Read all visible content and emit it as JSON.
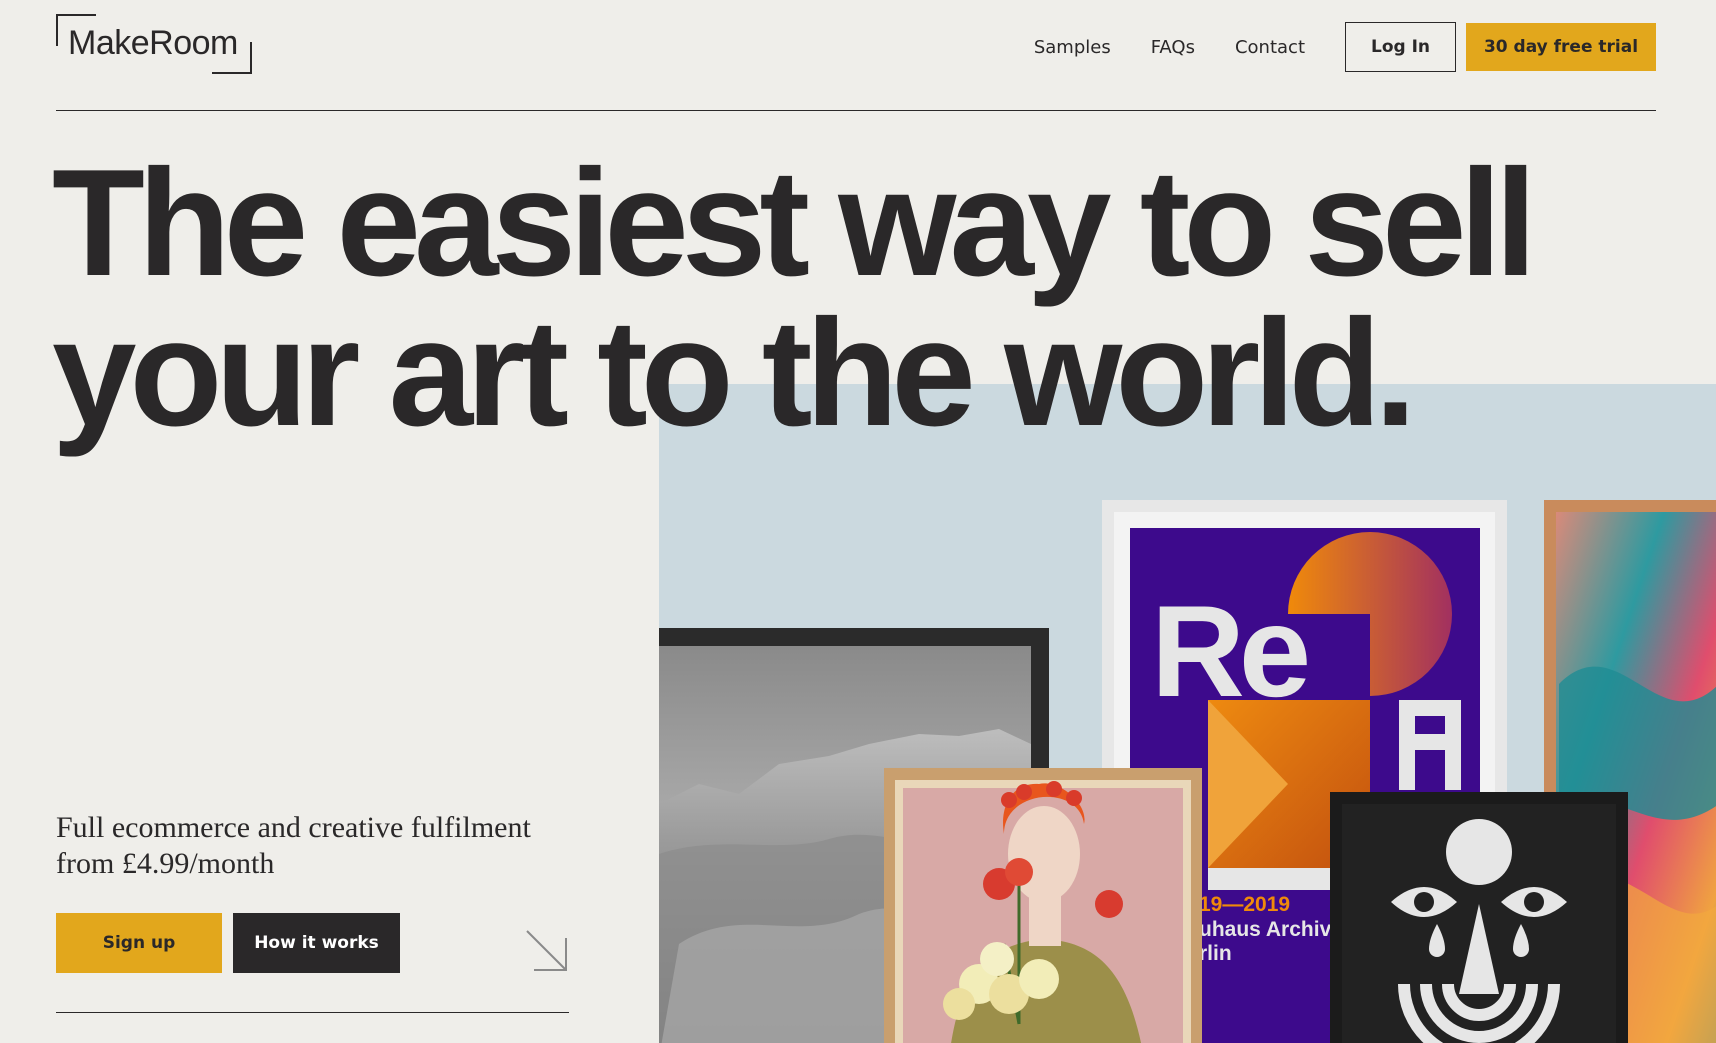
{
  "brand": {
    "name": "MakeRoom"
  },
  "nav": {
    "items": [
      {
        "label": "Samples"
      },
      {
        "label": "FAQs"
      },
      {
        "label": "Contact"
      }
    ],
    "login_label": "Log In",
    "trial_label": "30 day free trial"
  },
  "hero": {
    "headline_line1": "The easiest way to sell",
    "headline_line2": "your art to the world.",
    "subcopy": "Full ecommerce and creative fulfilment from £4.99/month",
    "signup_label": "Sign up",
    "how_label": "How it works",
    "arrow_icon": "arrow-down-right-icon",
    "poster_text_top": "Re",
    "poster_text_dates": "19—2019",
    "poster_text_line2": "uhaus Archiv",
    "poster_text_line3": "rlin"
  },
  "colors": {
    "accent": "#e2a71c",
    "dark": "#2a2829",
    "background": "#efeeea",
    "wall": "#cbd9df",
    "poster_purple": "#3d0a8c",
    "poster_orange": "#e0700f"
  }
}
